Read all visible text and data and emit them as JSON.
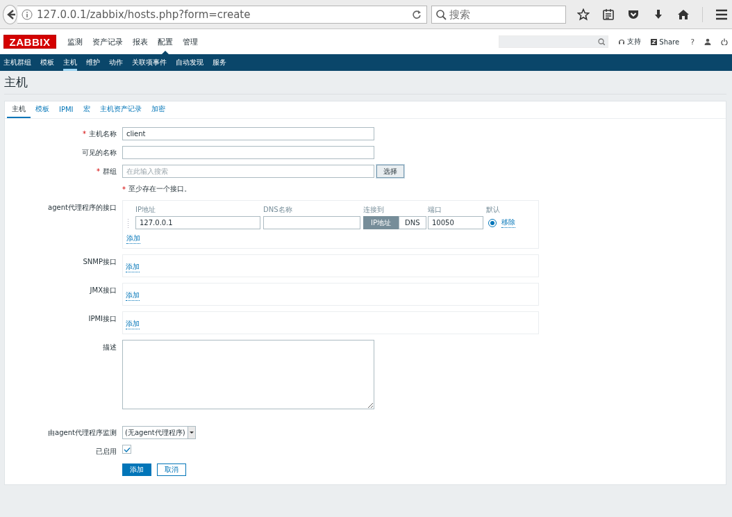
{
  "browser": {
    "url": "127.0.0.1/zabbix/hosts.php?form=create",
    "search_placeholder": "搜索"
  },
  "header": {
    "logo": "ZABBIX",
    "menu": [
      {
        "label": "监测",
        "selected": false
      },
      {
        "label": "资产记录",
        "selected": false
      },
      {
        "label": "报表",
        "selected": false
      },
      {
        "label": "配置",
        "selected": true
      },
      {
        "label": "管理",
        "selected": false
      }
    ],
    "support": "支持",
    "share": "Share",
    "help": "?"
  },
  "subnav": [
    {
      "label": "主机群组",
      "selected": false
    },
    {
      "label": "模板",
      "selected": false
    },
    {
      "label": "主机",
      "selected": true
    },
    {
      "label": "维护",
      "selected": false
    },
    {
      "label": "动作",
      "selected": false
    },
    {
      "label": "关联项事件",
      "selected": false
    },
    {
      "label": "自动发现",
      "selected": false
    },
    {
      "label": "服务",
      "selected": false
    }
  ],
  "page_title": "主机",
  "tabs": [
    {
      "label": "主机",
      "selected": true
    },
    {
      "label": "模板",
      "selected": false
    },
    {
      "label": "IPMI",
      "selected": false
    },
    {
      "label": "宏",
      "selected": false
    },
    {
      "label": "主机资产记录",
      "selected": false
    },
    {
      "label": "加密",
      "selected": false
    }
  ],
  "form": {
    "host_name": {
      "label": "主机名称",
      "required_mark": "*",
      "value": "client"
    },
    "visible_name": {
      "label": "可见的名称"
    },
    "groups": {
      "label": "群组",
      "required_mark": "*",
      "placeholder": "在此输入搜索",
      "button": "选择"
    },
    "interface_note": {
      "text": "至少存在一个接口。",
      "required_mark": "*"
    },
    "interfaces": [
      {
        "label": "agent代理程序的接口",
        "columns": [
          "IP地址",
          "DNS名称",
          "连接到",
          "端口",
          "默认"
        ],
        "rows": [
          {
            "ip": "127.0.0.1",
            "connect": [
              {
                "label": "IP地址",
                "selected": true
              },
              {
                "label": "DNS",
                "selected": false
              }
            ],
            "port": "10050",
            "default": true,
            "remove": "移除"
          }
        ],
        "add": "添加"
      },
      {
        "label": "SNMP接口",
        "add": "添加"
      },
      {
        "label": "JMX接口",
        "add": "添加"
      },
      {
        "label": "IPMI接口",
        "add": "添加"
      }
    ],
    "description": {
      "label": "描述"
    },
    "proxy": {
      "label": "由agent代理程序监测",
      "value": "(无agent代理程序)"
    },
    "enabled": {
      "label": "已启用",
      "checked": true
    },
    "buttons": [
      {
        "label": "添加",
        "kind": "primary"
      },
      {
        "label": "取消",
        "kind": "secondary"
      }
    ]
  }
}
